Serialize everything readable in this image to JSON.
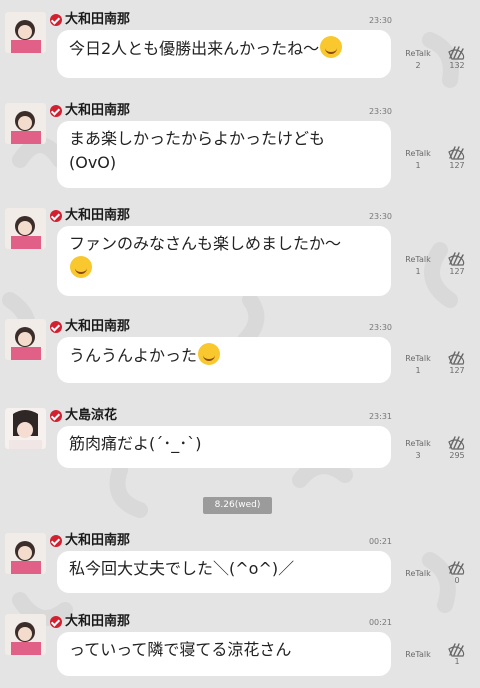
{
  "retalk_label": "ReTalk",
  "date_separator": "8.26(wed)",
  "colors": {
    "background": "#e4e4e4",
    "bubble": "#ffffff",
    "verified_badge": "#d32030",
    "date_pill": "#9b9b9b"
  },
  "messages": [
    {
      "sender": "大和田南那",
      "time": "23:30",
      "text": "今日2人とも優勝出来んかったね〜",
      "emoji": "sad-face",
      "retalk": "2",
      "likes": "132"
    },
    {
      "sender": "大和田南那",
      "time": "23:30",
      "text": "まあ楽しかったからよかったけども",
      "text2": "(OvO)",
      "retalk": "1",
      "likes": "127"
    },
    {
      "sender": "大和田南那",
      "time": "23:30",
      "text": "ファンのみなさんも楽しめましたか〜",
      "emoji": "smile-face",
      "retalk": "1",
      "likes": "127"
    },
    {
      "sender": "大和田南那",
      "time": "23:30",
      "text": "うんうんよかった",
      "emoji": "grin-face",
      "retalk": "1",
      "likes": "127"
    },
    {
      "sender": "大島涼花",
      "time": "23:31",
      "text": "筋肉痛だよ(´･_･`)",
      "retalk": "3",
      "likes": "295"
    },
    {
      "sender": "大和田南那",
      "time": "00:21",
      "text": "私今回大丈夫でした＼(^o^)／",
      "retalk": "",
      "likes": "0"
    },
    {
      "sender": "大和田南那",
      "time": "00:21",
      "text": "っていって隣で寝てる涼花さん",
      "retalk": "",
      "likes": "1"
    }
  ]
}
